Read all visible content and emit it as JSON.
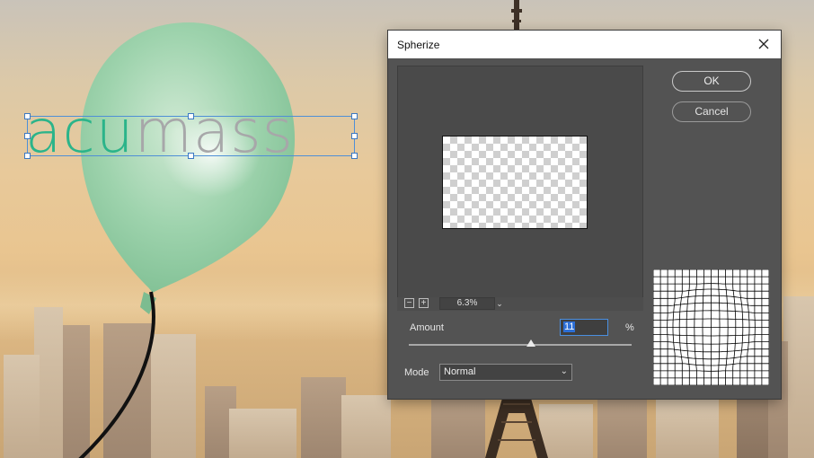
{
  "canvas": {
    "logo_part1": "acu",
    "logo_part2": "mass"
  },
  "dialog": {
    "title": "Spherize",
    "close_icon": "close-icon",
    "ok_label": "OK",
    "cancel_label": "Cancel",
    "zoom": {
      "value": "6.3%",
      "zoom_out_symbol": "−",
      "zoom_in_symbol": "+",
      "dropdown_icon": "chevron-down-icon"
    },
    "amount": {
      "label": "Amount",
      "value": "11",
      "unit": "%",
      "slider_fraction": 0.55
    },
    "mode": {
      "label": "Mode",
      "value": "Normal",
      "icon": "chevron-down-icon"
    }
  },
  "colors": {
    "dialog_bg": "#535353",
    "accent_highlight": "#2d6fd6",
    "logo_green": "#2bb48a",
    "logo_gray": "#a7a7a9"
  }
}
